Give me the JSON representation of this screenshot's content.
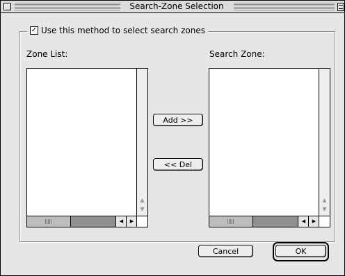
{
  "window": {
    "title": "Search-Zone Selection"
  },
  "options": {
    "use_method_label": "Use this method to select search zones",
    "use_method_checked": true,
    "check_mark": "✓"
  },
  "zone_list": {
    "label": "Zone List:",
    "items": []
  },
  "search_zone": {
    "label": "Search Zone:",
    "items": []
  },
  "buttons": {
    "add": "Add >>",
    "del": "<< Del",
    "cancel": "Cancel",
    "ok": "OK"
  },
  "scroll_glyphs": {
    "up": "▲",
    "down": "▼",
    "left": "◀",
    "right": "▶"
  }
}
